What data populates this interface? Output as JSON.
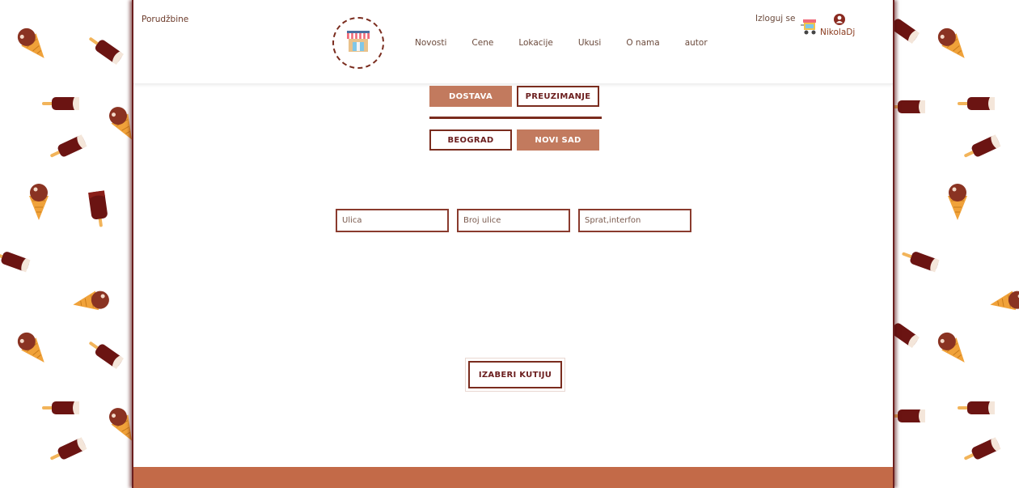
{
  "header": {
    "orders_link": "Porudžbine",
    "logo_icon": "shop-icon",
    "nav": [
      "Novosti",
      "Cene",
      "Lokacije",
      "Ukusi",
      "O nama",
      "autor"
    ],
    "logout_label": "Izloguj se",
    "cart_icon": "ice-cream-cart-icon",
    "user_icon": "user-icon",
    "username": "NikolaDj"
  },
  "delivery_toggle": {
    "options": [
      {
        "label": "DOSTAVA",
        "active": true
      },
      {
        "label": "PREUZIMANJE",
        "active": false
      }
    ]
  },
  "city_toggle": {
    "options": [
      {
        "label": "BEOGRAD",
        "active": false
      },
      {
        "label": "NOVI SAD",
        "active": true
      }
    ]
  },
  "address_form": {
    "street": {
      "value": "",
      "placeholder": "Ulica"
    },
    "number": {
      "value": "",
      "placeholder": "Broj ulice"
    },
    "floor": {
      "value": "",
      "placeholder": "Sprat,interfon"
    }
  },
  "choose_box_label": "IZABERI KUTIJU",
  "colors": {
    "accent": "#c27a5e",
    "dark_brown": "#7a2c1e",
    "footer": "#c36a48",
    "chocolate": "#6b1412",
    "waffle": "#f0a23a"
  }
}
